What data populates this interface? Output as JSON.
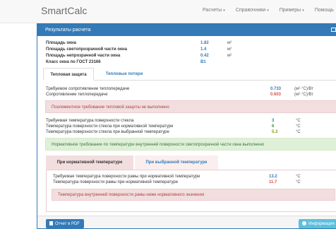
{
  "app": {
    "brand": "SmartCalc"
  },
  "nav": [
    {
      "label": "Расчеты",
      "caret": "▾"
    },
    {
      "label": "Справочники",
      "caret": "▾"
    },
    {
      "label": "Примеры",
      "caret": "▾"
    },
    {
      "label": "Помощь"
    }
  ],
  "panel": {
    "title": "Результаты расчета"
  },
  "summary": [
    {
      "label": "Площадь окна",
      "value": "1.82",
      "unit": "м²"
    },
    {
      "label": "Площадь светопрозрачной части окна",
      "value": "1.4",
      "unit": "м²"
    },
    {
      "label": "Площадь непрозрачной части окна",
      "value": "0.42",
      "unit": "м²"
    },
    {
      "label": "Класс окна по ГОСТ 23166",
      "value": "B1",
      "unit": ""
    }
  ],
  "tabs": [
    {
      "label": "Тепловая защита",
      "active": true
    },
    {
      "label": "Тепловые потери",
      "active": false
    }
  ],
  "resistance": [
    {
      "label": "Требуемое сопротивление теплопередаче",
      "value": "0.733",
      "unit": "(м²·°C)/Вт"
    },
    {
      "label": "Сопротивление теплопередаче",
      "value": "0.603",
      "unit": "(м²·°C)/Вт"
    }
  ],
  "alert_protection": "Поэлементное требование тепловой защиты не выполнено",
  "glass_temps": [
    {
      "label": "Требуемая температура поверхности стекла",
      "value": "3",
      "unit": "°C"
    },
    {
      "label": "Температура поверхности стекла при нормативной температуре",
      "value": "6",
      "unit": "°C"
    },
    {
      "label": "Температура поверхности стекла при выбранной температуре",
      "value": "5.3",
      "unit": "°C"
    }
  ],
  "alert_glass": "Нормативное требование по температуре внутренней поверхности светопрозрачной части окна выполнено",
  "subtabs": [
    {
      "label": "При нормативной температуре",
      "active": true
    },
    {
      "label": "При выбранной температуре",
      "active": false
    }
  ],
  "frame_temps": [
    {
      "label": "Требуемая температура поверхности рамы при нормативной температуре",
      "value": "13.2",
      "unit": "°C"
    },
    {
      "label": "Температура поверхности рамы при нормативной температуре",
      "value": "11.7",
      "unit": "°C"
    }
  ],
  "alert_frame": "Температура внутренней поверхности рамы ниже нормативного значения",
  "footer": {
    "pdf_label": "Отчет в PDF",
    "info_label": "Информация"
  }
}
